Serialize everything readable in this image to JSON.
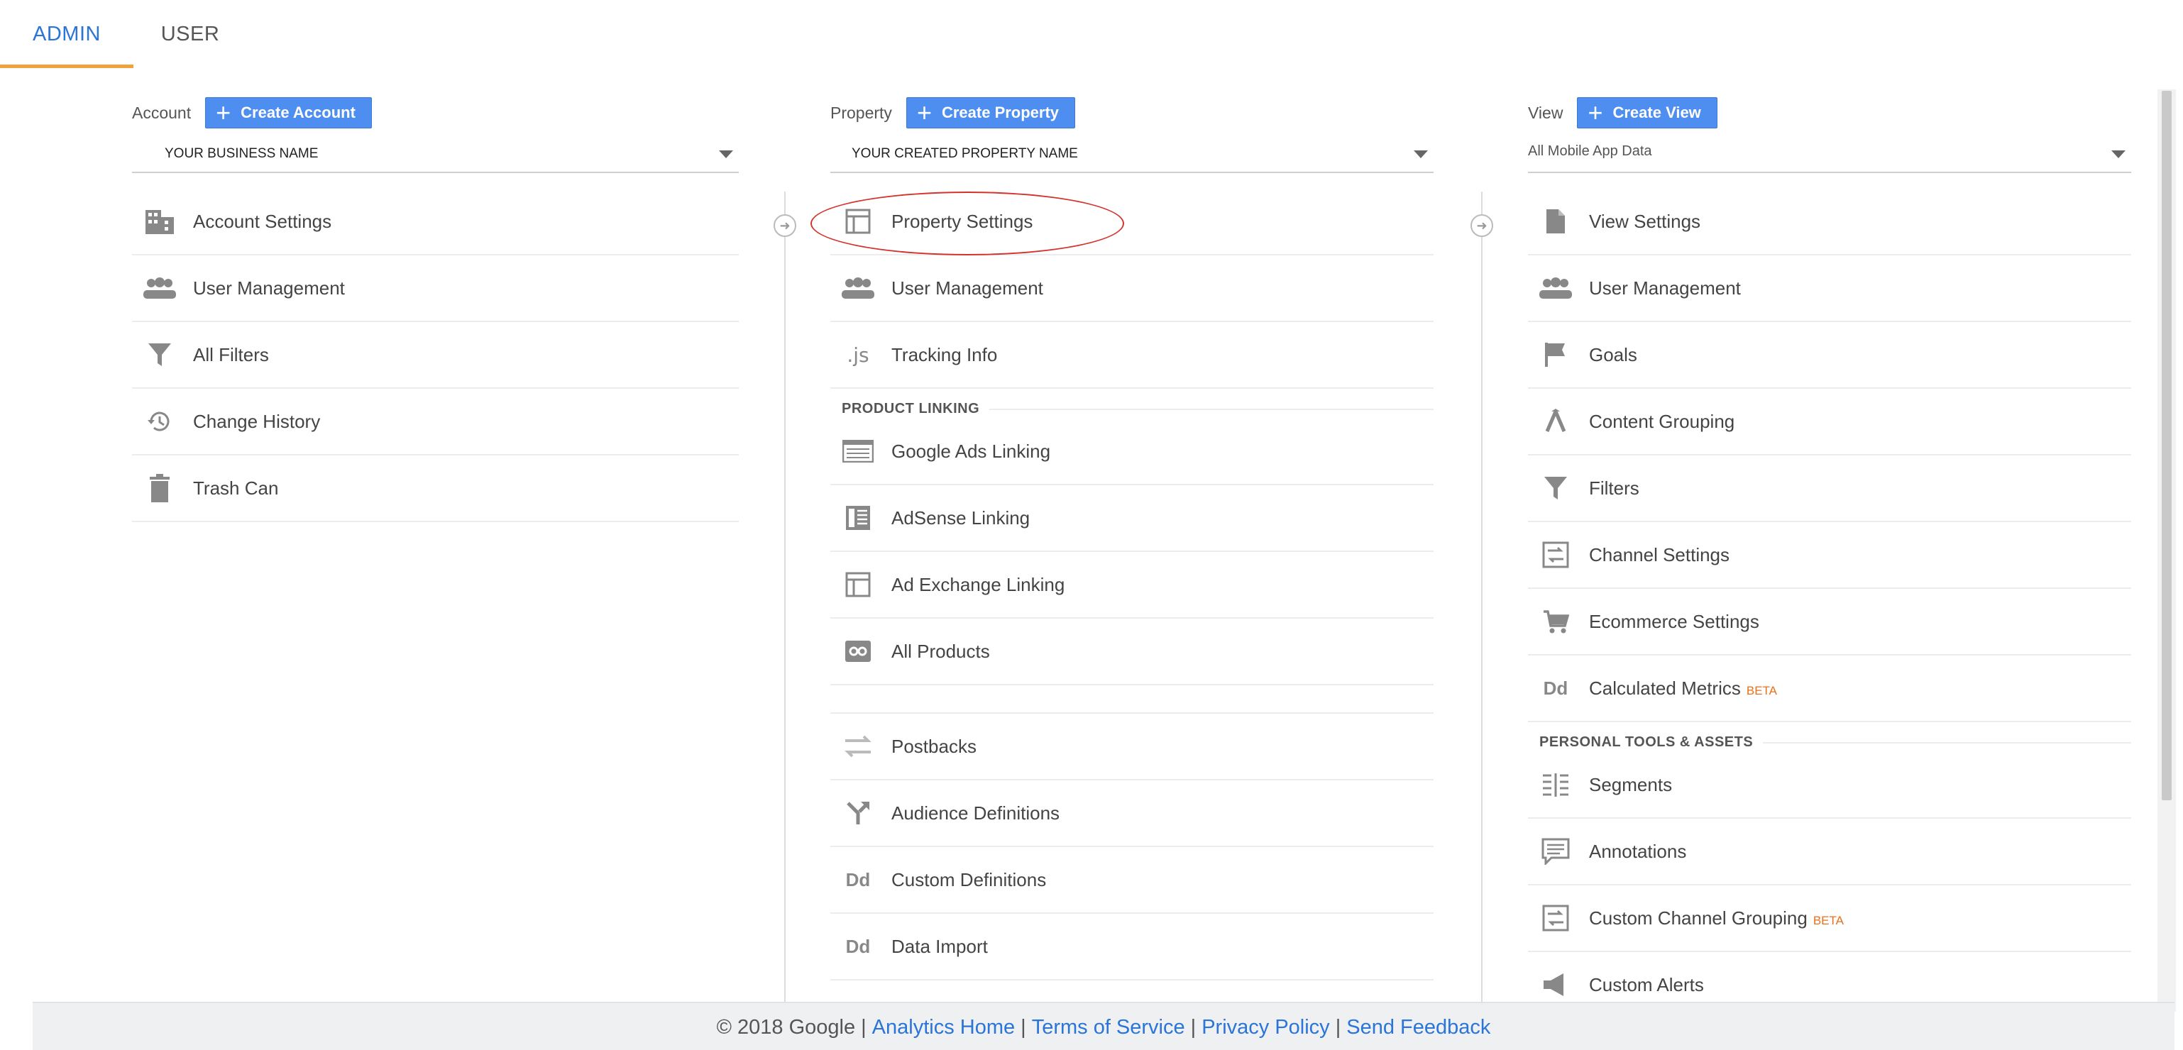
{
  "tabs": {
    "admin": "ADMIN",
    "user": "USER"
  },
  "account": {
    "label": "Account",
    "create_label": "Create Account",
    "selected": "YOUR BUSINESS NAME",
    "items": [
      {
        "label": "Account Settings",
        "icon": "building-icon"
      },
      {
        "label": "User Management",
        "icon": "people-icon"
      },
      {
        "label": "All Filters",
        "icon": "filter-icon"
      },
      {
        "label": "Change History",
        "icon": "history-icon"
      },
      {
        "label": "Trash Can",
        "icon": "trash-icon"
      }
    ]
  },
  "property": {
    "label": "Property",
    "create_label": "Create Property",
    "selected": "YOUR CREATED PROPERTY NAME",
    "items": [
      {
        "label": "Property Settings",
        "icon": "layout-icon"
      },
      {
        "label": "User Management",
        "icon": "people-icon"
      },
      {
        "label": "Tracking Info",
        "icon": "js-icon"
      }
    ],
    "section_title": "PRODUCT LINKING",
    "linking_items": [
      {
        "label": "Google Ads Linking",
        "icon": "ads-icon"
      },
      {
        "label": "AdSense Linking",
        "icon": "adsense-icon"
      },
      {
        "label": "Ad Exchange Linking",
        "icon": "adx-icon"
      },
      {
        "label": "All Products",
        "icon": "link-icon"
      }
    ],
    "more_items": [
      {
        "label": "Postbacks",
        "icon": "swap-icon"
      },
      {
        "label": "Audience Definitions",
        "icon": "fork-icon"
      },
      {
        "label": "Custom Definitions",
        "icon": "dd-icon"
      },
      {
        "label": "Data Import",
        "icon": "dd-icon"
      }
    ]
  },
  "view": {
    "label": "View",
    "create_label": "Create View",
    "selected": "All Mobile App Data",
    "items": [
      {
        "label": "View Settings",
        "icon": "file-icon"
      },
      {
        "label": "User Management",
        "icon": "people-icon"
      },
      {
        "label": "Goals",
        "icon": "flag-icon"
      },
      {
        "label": "Content Grouping",
        "icon": "grouping-icon"
      },
      {
        "label": "Filters",
        "icon": "filter-icon"
      },
      {
        "label": "Channel Settings",
        "icon": "channel-icon"
      },
      {
        "label": "Ecommerce Settings",
        "icon": "cart-icon"
      },
      {
        "label": "Calculated Metrics",
        "icon": "dd-icon",
        "badge": "BETA"
      }
    ],
    "section_title": "PERSONAL TOOLS & ASSETS",
    "personal_items": [
      {
        "label": "Segments",
        "icon": "segments-icon"
      },
      {
        "label": "Annotations",
        "icon": "comment-icon"
      },
      {
        "label": "Custom Channel Grouping",
        "icon": "channel-icon",
        "badge": "BETA"
      },
      {
        "label": "Custom Alerts",
        "icon": "megaphone-icon"
      }
    ]
  },
  "footer": {
    "copyright": "© 2018 Google",
    "links": [
      "Analytics Home",
      "Terms of Service",
      "Privacy Policy",
      "Send Feedback"
    ]
  }
}
